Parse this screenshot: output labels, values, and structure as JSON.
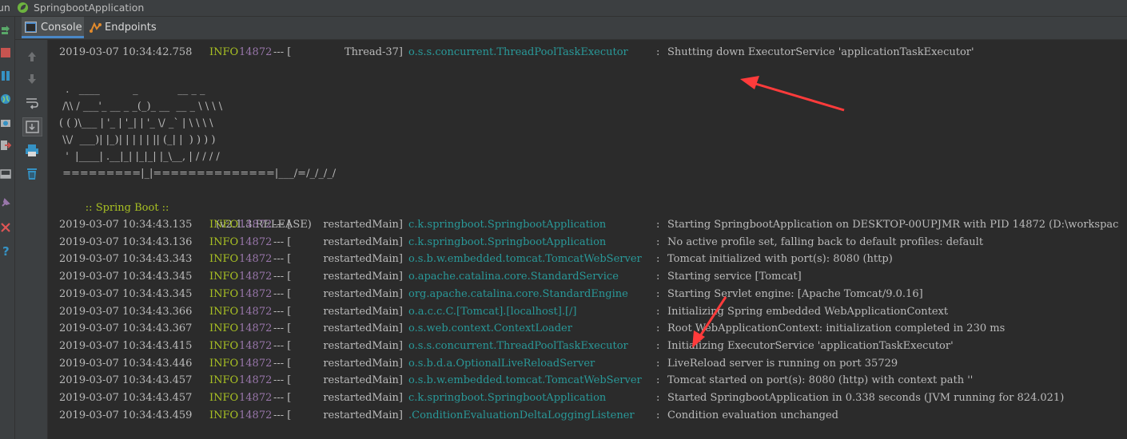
{
  "titlebar": {
    "run_label": "un",
    "app_name": "SpringbootApplication"
  },
  "tabs": [
    {
      "label": "Console",
      "icon": "console-icon",
      "active": true
    },
    {
      "label": "Endpoints",
      "icon": "endpoints-icon",
      "active": false
    }
  ],
  "gutter_icons": [
    "scroll-up-icon",
    "scroll-down-icon",
    "soft-wrap-icon",
    "scroll-to-end-icon",
    "print-icon",
    "trash-icon"
  ],
  "left_toolbar_icons": [
    "rerun-icon",
    "stop-icon",
    "pause-icon",
    "globe-icon",
    "camera-icon",
    "exit-icon",
    "layout-icon",
    "pin-icon",
    "close-icon",
    "help-icon"
  ],
  "colors": {
    "level": "#a8c023",
    "pid": "#9876aa",
    "logger": "#299999",
    "arrow": "#ff3b3b"
  },
  "console": {
    "first_line": {
      "ts": "2019-03-07 10:34:42.758",
      "level": "INFO",
      "pid": "14872",
      "sep": "--- [",
      "thread": "Thread-37]",
      "logger": "o.s.s.concurrent.ThreadPoolTaskExecutor",
      "colon": ":",
      "msg": "Shutting down ExecutorService 'applicationTaskExecutor'"
    },
    "banner": [
      "  .   ____          _            __ _ _",
      " /\\\\ / ___'_ __ _ _(_)_ __  __ _ \\ \\ \\ \\",
      "( ( )\\___ | '_ | '_| | '_ \\/ _` | \\ \\ \\ \\",
      " \\\\/  ___)| |_)| | | | | || (_| |  ) ) ) )",
      "  '  |____| .__|_| |_|_| |_\\__, | / / / /",
      " =========|_|==============|___/=/_/_/_/"
    ],
    "spring_boot_label": ":: Spring Boot ::",
    "spring_boot_version": "(v2.1.3.RELEASE)",
    "lines": [
      {
        "ts": "2019-03-07 10:34:43.135",
        "level": "INFO",
        "pid": "14872",
        "sep": "--- [",
        "thread": "restartedMain]",
        "logger": "c.k.springboot.SpringbootApplication",
        "colon": ":",
        "msg": "Starting SpringbootApplication on DESKTOP-00UPJMR with PID 14872 (D:\\workspac"
      },
      {
        "ts": "2019-03-07 10:34:43.136",
        "level": "INFO",
        "pid": "14872",
        "sep": "--- [",
        "thread": "restartedMain]",
        "logger": "c.k.springboot.SpringbootApplication",
        "colon": ":",
        "msg": "No active profile set, falling back to default profiles: default"
      },
      {
        "ts": "2019-03-07 10:34:43.343",
        "level": "INFO",
        "pid": "14872",
        "sep": "--- [",
        "thread": "restartedMain]",
        "logger": "o.s.b.w.embedded.tomcat.TomcatWebServer",
        "colon": ":",
        "msg": "Tomcat initialized with port(s): 8080 (http)"
      },
      {
        "ts": "2019-03-07 10:34:43.345",
        "level": "INFO",
        "pid": "14872",
        "sep": "--- [",
        "thread": "restartedMain]",
        "logger": "o.apache.catalina.core.StandardService",
        "colon": ":",
        "msg": "Starting service [Tomcat]"
      },
      {
        "ts": "2019-03-07 10:34:43.345",
        "level": "INFO",
        "pid": "14872",
        "sep": "--- [",
        "thread": "restartedMain]",
        "logger": "org.apache.catalina.core.StandardEngine",
        "colon": ":",
        "msg": "Starting Servlet engine: [Apache Tomcat/9.0.16]"
      },
      {
        "ts": "2019-03-07 10:34:43.366",
        "level": "INFO",
        "pid": "14872",
        "sep": "--- [",
        "thread": "restartedMain]",
        "logger": "o.a.c.c.C.[Tomcat].[localhost].[/]",
        "colon": ":",
        "msg": "Initializing Spring embedded WebApplicationContext"
      },
      {
        "ts": "2019-03-07 10:34:43.367",
        "level": "INFO",
        "pid": "14872",
        "sep": "--- [",
        "thread": "restartedMain]",
        "logger": "o.s.web.context.ContextLoader",
        "colon": ":",
        "msg": "Root WebApplicationContext: initialization completed in 230 ms"
      },
      {
        "ts": "2019-03-07 10:34:43.415",
        "level": "INFO",
        "pid": "14872",
        "sep": "--- [",
        "thread": "restartedMain]",
        "logger": "o.s.s.concurrent.ThreadPoolTaskExecutor",
        "colon": ":",
        "msg": "Initializing ExecutorService 'applicationTaskExecutor'"
      },
      {
        "ts": "2019-03-07 10:34:43.446",
        "level": "INFO",
        "pid": "14872",
        "sep": "--- [",
        "thread": "restartedMain]",
        "logger": "o.s.b.d.a.OptionalLiveReloadServer",
        "colon": ":",
        "msg": "LiveReload server is running on port 35729"
      },
      {
        "ts": "2019-03-07 10:34:43.457",
        "level": "INFO",
        "pid": "14872",
        "sep": "--- [",
        "thread": "restartedMain]",
        "logger": "o.s.b.w.embedded.tomcat.TomcatWebServer",
        "colon": ":",
        "msg": "Tomcat started on port(s): 8080 (http) with context path ''"
      },
      {
        "ts": "2019-03-07 10:34:43.457",
        "level": "INFO",
        "pid": "14872",
        "sep": "--- [",
        "thread": "restartedMain]",
        "logger": "c.k.springboot.SpringbootApplication",
        "colon": ":",
        "msg": "Started SpringbootApplication in 0.338 seconds (JVM running for 824.021)"
      },
      {
        "ts": "2019-03-07 10:34:43.459",
        "level": "INFO",
        "pid": "14872",
        "sep": "--- [",
        "thread": "restartedMain]",
        "logger": ".ConditionEvaluationDeltaLoggingListener",
        "colon": ":",
        "msg": "Condition evaluation unchanged"
      }
    ]
  }
}
